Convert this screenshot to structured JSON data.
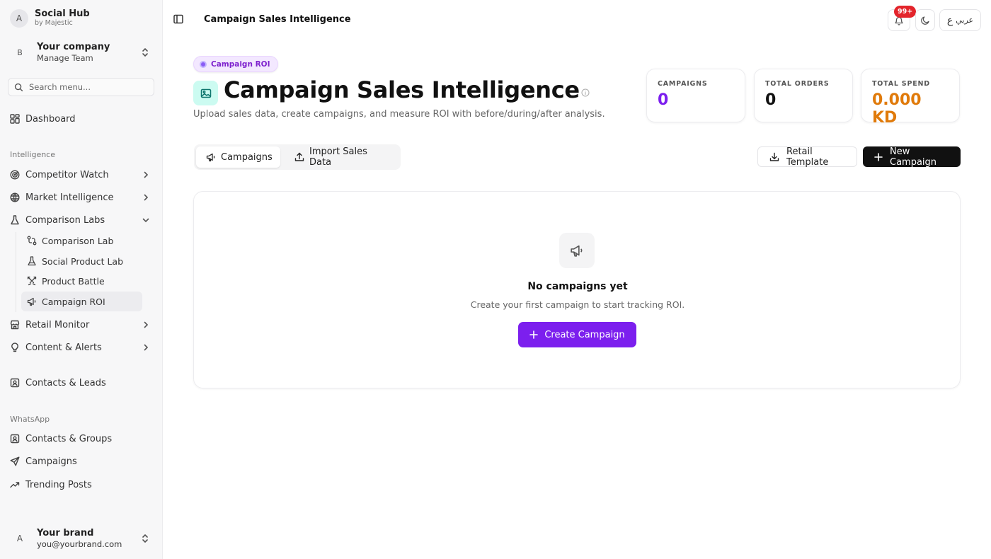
{
  "sidebar": {
    "brand": {
      "avatar": "A",
      "title": "Social Hub",
      "subtitle": "by Majestic"
    },
    "company": {
      "avatar": "B",
      "name": "Your company",
      "subtitle": "Manage Team"
    },
    "search_placeholder": "Search menu...",
    "dashboard": "Dashboard",
    "intelligence_label": "Intelligence",
    "competitor_watch": "Competitor Watch",
    "market_intelligence": "Market Intelligence",
    "comparison_labs": "Comparison Labs",
    "comparison_lab": "Comparison Lab",
    "social_product_lab": "Social Product Lab",
    "product_battle": "Product Battle",
    "campaign_roi": "Campaign ROI",
    "retail_monitor": "Retail Monitor",
    "content_alerts": "Content & Alerts",
    "contacts_leads": "Contacts & Leads",
    "whatsapp_label": "WhatsApp",
    "contacts_groups": "Contacts & Groups",
    "campaigns": "Campaigns",
    "trending_posts": "Trending Posts",
    "user": {
      "avatar": "A",
      "name": "Your brand",
      "email": "you@yourbrand.com"
    }
  },
  "topbar": {
    "title": "Campaign Sales Intelligence",
    "notification_badge": "99+",
    "language_label": "عربي",
    "language_glyph": "ع"
  },
  "header": {
    "pill": "Campaign ROI",
    "title": "Campaign Sales Intelligence",
    "subtitle": "Upload sales data, create campaigns, and measure ROI with before/during/after analysis."
  },
  "stats": [
    {
      "label": "CAMPAIGNS",
      "value": "0",
      "color": "#7c1fee"
    },
    {
      "label": "TOTAL ORDERS",
      "value": "0",
      "color": "#111111"
    },
    {
      "label": "TOTAL SPEND",
      "value": "0.000 KD",
      "color": "#e07a0a"
    }
  ],
  "tabs": {
    "campaigns": "Campaigns",
    "import": "Import Sales Data"
  },
  "actions": {
    "retail_template": "Retail Template",
    "new_campaign": "New Campaign"
  },
  "empty": {
    "title": "No campaigns yet",
    "subtitle": "Create your first campaign to start tracking ROI.",
    "button": "Create Campaign"
  },
  "colors": {
    "accent": "#7c1fee",
    "badge": "#e3242b",
    "spend": "#e07a0a"
  }
}
